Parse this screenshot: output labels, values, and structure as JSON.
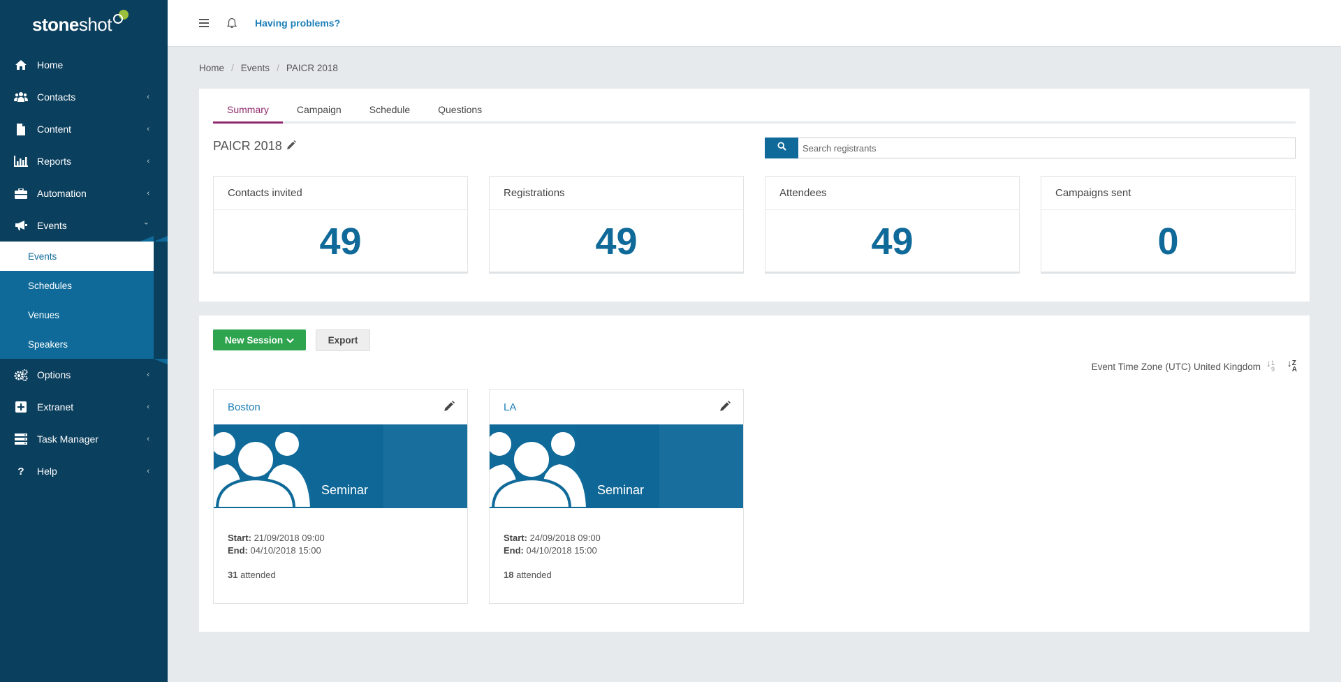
{
  "brand": {
    "bold": "stone",
    "light": "shot"
  },
  "sidebar": {
    "items": [
      {
        "label": "Home",
        "icon": "home-icon",
        "chevron": false
      },
      {
        "label": "Contacts",
        "icon": "users-icon",
        "chevron": true
      },
      {
        "label": "Content",
        "icon": "file-icon",
        "chevron": true
      },
      {
        "label": "Reports",
        "icon": "bar-chart-icon",
        "chevron": true
      },
      {
        "label": "Automation",
        "icon": "briefcase-icon",
        "chevron": true
      },
      {
        "label": "Events",
        "icon": "megaphone-icon",
        "chevron": true,
        "open": true
      }
    ],
    "events_submenu": [
      "Events",
      "Schedules",
      "Venues",
      "Speakers"
    ],
    "items_after": [
      {
        "label": "Options",
        "icon": "gears-icon"
      },
      {
        "label": "Extranet",
        "icon": "plus-square-icon"
      },
      {
        "label": "Task Manager",
        "icon": "server-icon"
      },
      {
        "label": "Help",
        "icon": "question-icon"
      }
    ],
    "chev_left": "‹",
    "chev_down": "⌄"
  },
  "topbar": {
    "problems": "Having problems?"
  },
  "breadcrumb": {
    "home": "Home",
    "events": "Events",
    "current": "PAICR 2018",
    "sep": "/"
  },
  "tabs": [
    "Summary",
    "Campaign",
    "Schedule",
    "Questions"
  ],
  "event": {
    "title": "PAICR 2018"
  },
  "search": {
    "placeholder": "Search registrants"
  },
  "stats": [
    {
      "label": "Contacts invited",
      "value": "49"
    },
    {
      "label": "Registrations",
      "value": "49"
    },
    {
      "label": "Attendees",
      "value": "49"
    },
    {
      "label": "Campaigns sent",
      "value": "0"
    }
  ],
  "actions": {
    "new_session": "New Session",
    "export": "Export"
  },
  "timezone": "Event Time Zone (UTC) United Kingdom",
  "sort": {
    "num_top": "1",
    "num_bottom": "9",
    "alpha_top": "Z",
    "alpha_bottom": "A"
  },
  "sessions": [
    {
      "title": "Boston",
      "type": "Seminar",
      "start_label": "Start:",
      "start": "21/09/2018 09:00",
      "end_label": "End:",
      "end": "04/10/2018 15:00",
      "attended_count": "31",
      "attended_label": "attended"
    },
    {
      "title": "LA",
      "type": "Seminar",
      "start_label": "Start:",
      "start": "24/09/2018 09:00",
      "end_label": "End:",
      "end": "04/10/2018 15:00",
      "attended_count": "18",
      "attended_label": "attended"
    }
  ],
  "colors": {
    "sidebar": "#0b3f5e",
    "submenu": "#0f6a99",
    "accent_tab": "#8e2a6c",
    "stat_value": "#0f6a99",
    "new_button": "#2ea44f",
    "link": "#1d7fb8"
  }
}
